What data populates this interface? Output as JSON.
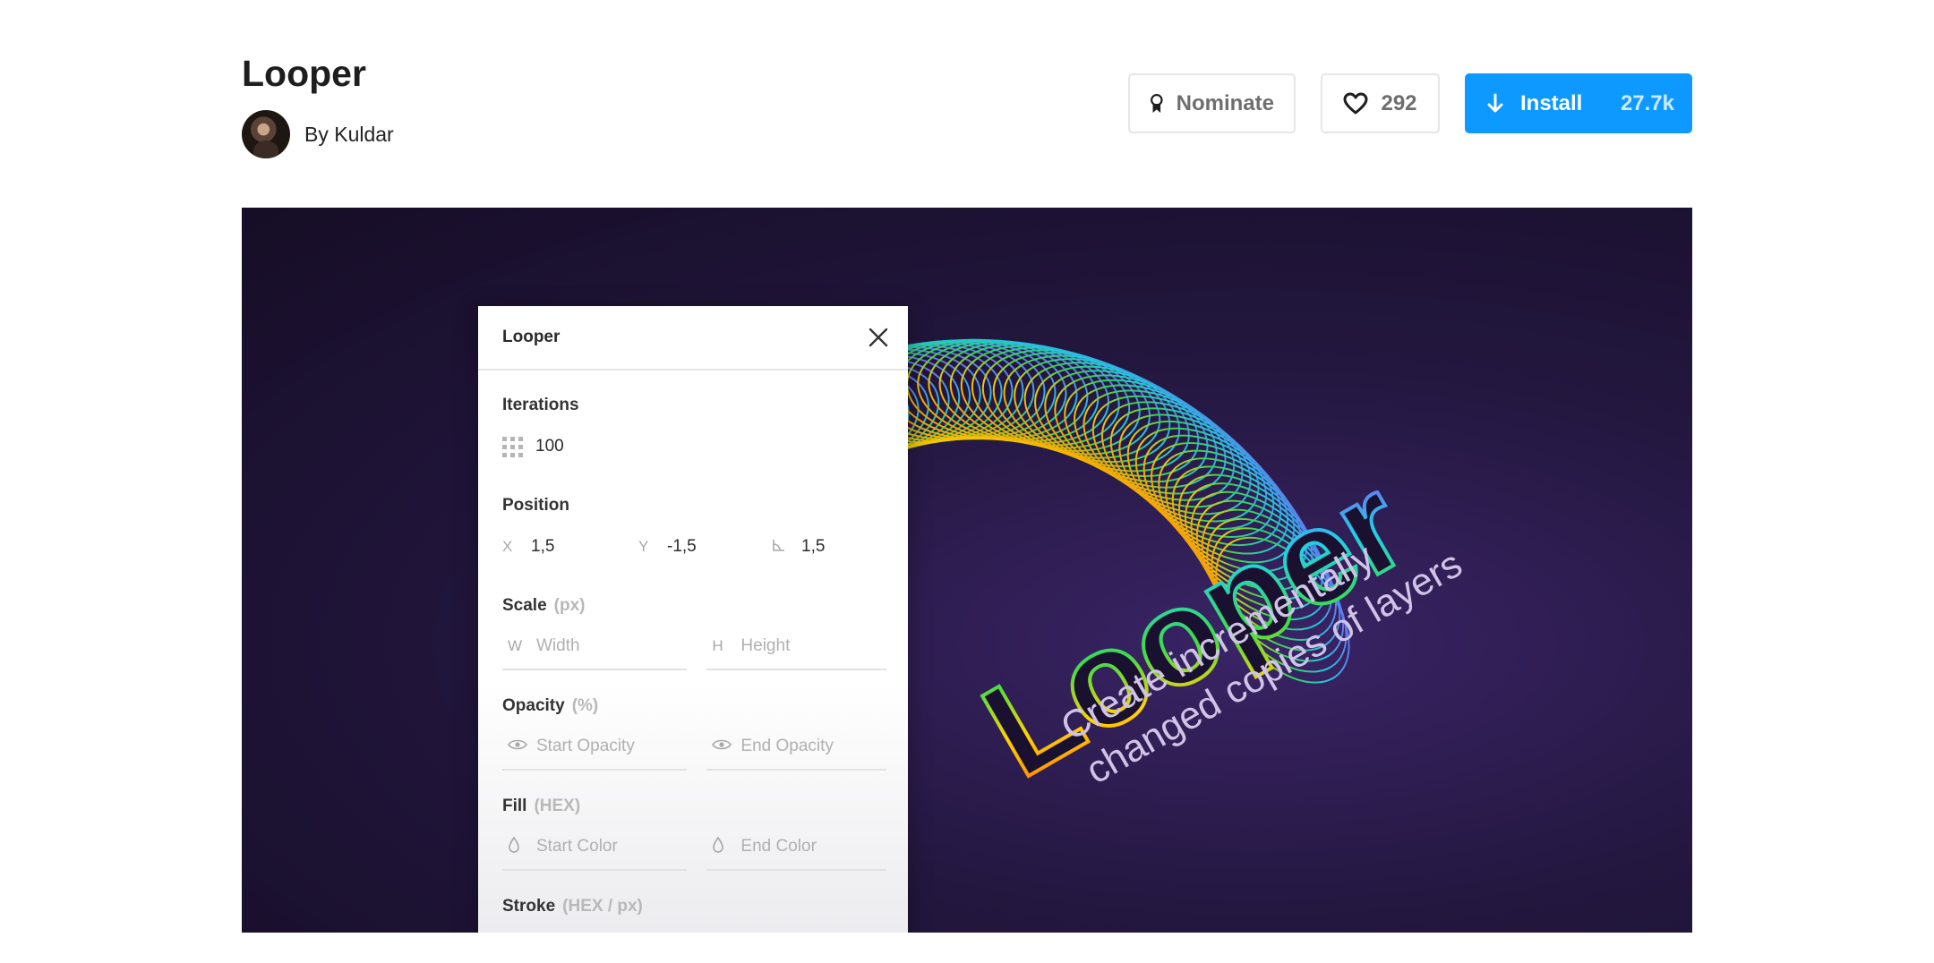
{
  "plugin": {
    "title": "Looper",
    "author": "By Kuldar"
  },
  "actions": {
    "nominate_label": "Nominate",
    "like_count": "292",
    "install_label": "Install",
    "install_count": "27.7k"
  },
  "colors": {
    "accent": "#0d99ff",
    "hero_bg": "#1c1232"
  },
  "hero": {
    "logo_text": "Looper",
    "tagline_line1": "Create incrementally",
    "tagline_line2": "changed copies of layers"
  },
  "panel": {
    "title": "Looper",
    "iterations": {
      "label": "Iterations",
      "value": "100"
    },
    "position": {
      "label": "Position",
      "x_label": "X",
      "x_value": "1,5",
      "y_label": "Y",
      "y_value": "-1,5",
      "angle_value": "1,5"
    },
    "scale": {
      "label": "Scale",
      "unit": "(px)",
      "w_label": "W",
      "w_placeholder": "Width",
      "h_label": "H",
      "h_placeholder": "Height"
    },
    "opacity": {
      "label": "Opacity",
      "unit": "(%)",
      "start_placeholder": "Start Opacity",
      "end_placeholder": "End Opacity"
    },
    "fill": {
      "label": "Fill",
      "unit": "(HEX)",
      "start_placeholder": "Start Color",
      "end_placeholder": "End Color"
    },
    "stroke": {
      "label": "Stroke",
      "unit": "(HEX / px)"
    }
  }
}
